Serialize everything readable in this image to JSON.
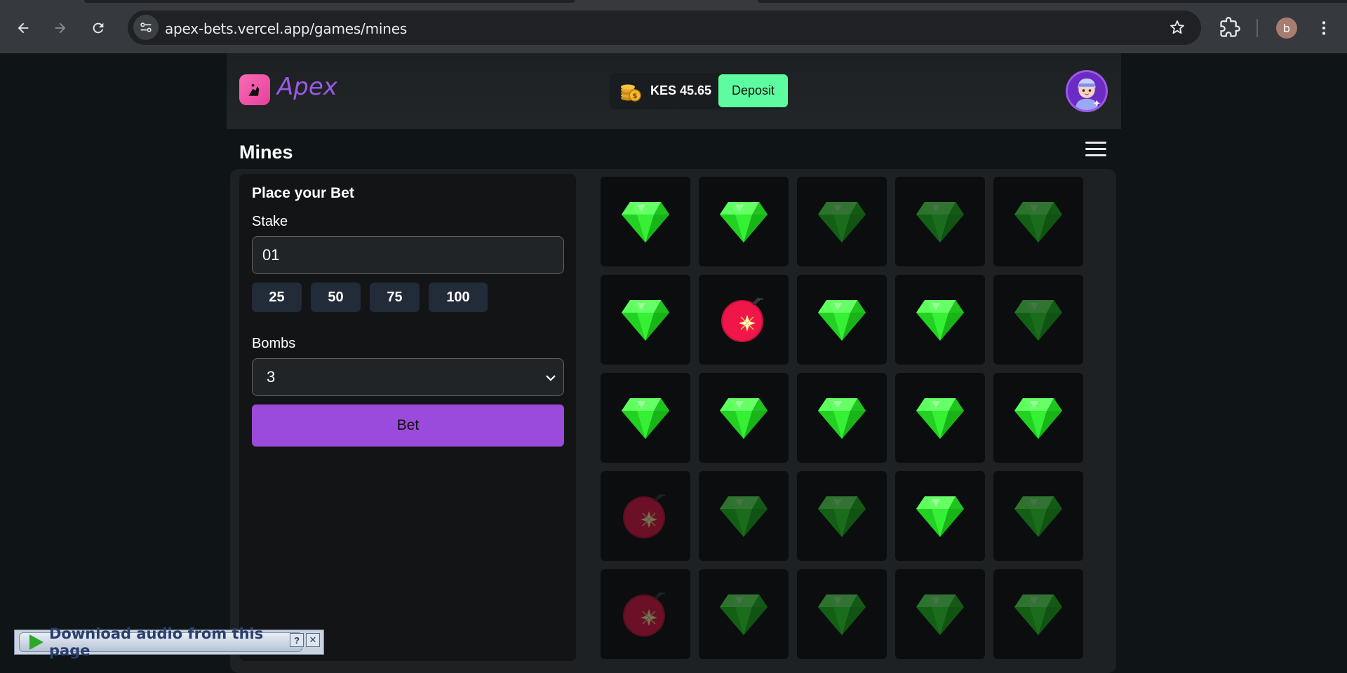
{
  "browser": {
    "url": "apex-bets.vercel.app/games/mines",
    "profile_initial": "b"
  },
  "header": {
    "brand": "Apex",
    "balance": "KES 45.65",
    "deposit_label": "Deposit"
  },
  "page": {
    "title": "Mines"
  },
  "bet_panel": {
    "title": "Place your Bet",
    "stake_label": "Stake",
    "stake_value": "01",
    "quick_amounts": [
      "25",
      "50",
      "75",
      "100"
    ],
    "bombs_label": "Bombs",
    "bombs_value": "3",
    "bet_label": "Bet"
  },
  "board": {
    "rows": [
      [
        "gem",
        "gem",
        "gem-dim",
        "gem-dim",
        "gem-dim"
      ],
      [
        "gem",
        "bomb",
        "gem",
        "gem",
        "gem-dim"
      ],
      [
        "gem",
        "gem",
        "gem",
        "gem",
        "gem"
      ],
      [
        "bomb-dim",
        "gem-dim",
        "gem-dim",
        "gem",
        "gem-dim"
      ],
      [
        "bomb-dim",
        "gem-dim",
        "gem-dim",
        "gem-dim",
        "gem-dim"
      ]
    ]
  },
  "extension_bar": {
    "label": "Download audio from this page",
    "help": "?",
    "close": "✕"
  },
  "colors": {
    "accent": "#9b4bdb",
    "deposit": "#5dfca0",
    "gem": "#33ff33",
    "bomb": "#f0164a"
  }
}
